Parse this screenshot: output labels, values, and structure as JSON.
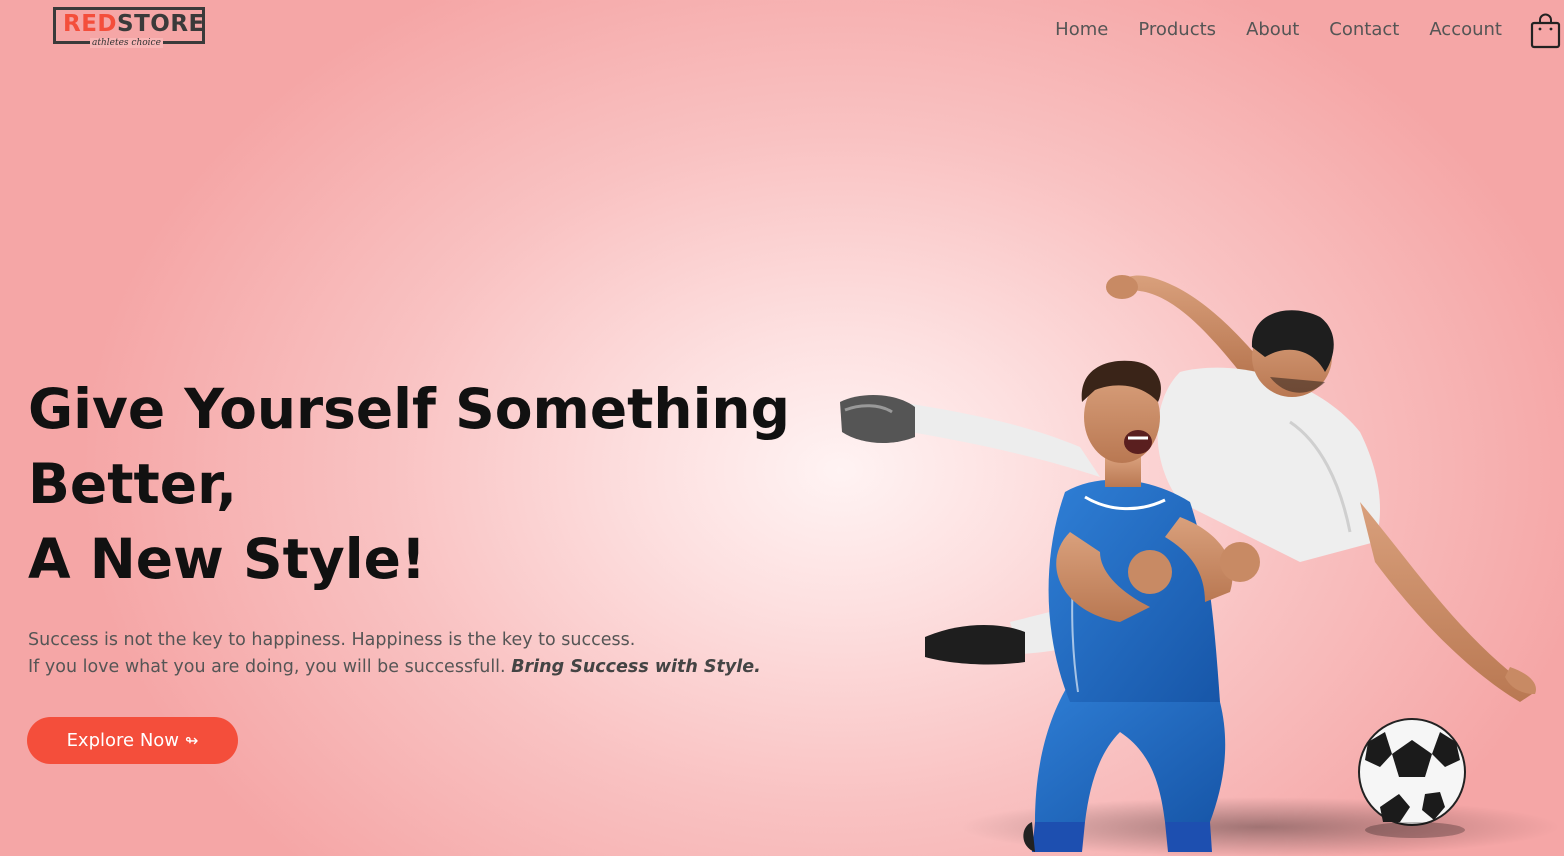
{
  "brand": {
    "name_part1": "RED",
    "name_part2": "STORE",
    "tagline": "athletes choice",
    "accent_color": "#f44e3b"
  },
  "nav": {
    "items": [
      "Home",
      "Products",
      "About",
      "Contact",
      "Account"
    ],
    "cart_icon": "shopping-bag-icon"
  },
  "hero": {
    "title_lines": [
      "Give Yourself Something",
      "Better,",
      "A New Style!"
    ],
    "subtitle_line1": "Success is not the key to happiness. Happiness is the key to success.",
    "subtitle_line2": "If you love what you are doing, you will be successfull.",
    "subtitle_emphasis": "Bring Success with Style.",
    "cta_label": "Explore Now",
    "cta_icon": "arrow-right-icon",
    "cta_arrow": "↬",
    "image_icon": "football-players-image"
  }
}
